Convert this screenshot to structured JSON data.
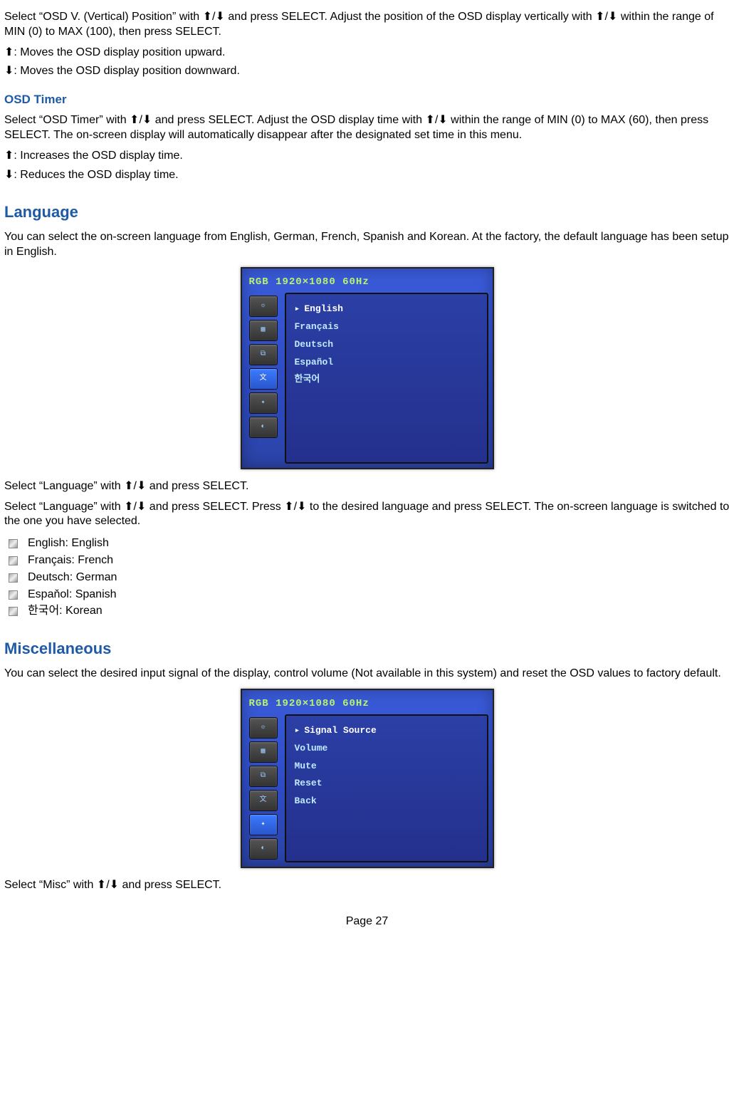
{
  "osdv": {
    "p1": "Select “OSD V. (Vertical) Position” with ⬆/⬇ and press SELECT. Adjust the position of the OSD display vertically with ⬆/⬇ within the range of MIN (0) to MAX (100), then press SELECT.",
    "up": "⬆: Moves the OSD display position upward.",
    "down": "⬇: Moves the OSD display position downward."
  },
  "timer": {
    "title": "OSD Timer",
    "p1": "Select “OSD Timer” with ⬆/⬇ and press SELECT. Adjust the OSD display time with ⬆/⬇ within the range of MIN (0) to MAX (60), then press SELECT. The on-screen display will automatically disappear after the designated set time in this menu.",
    "up": "⬆: Increases the OSD display time.",
    "down": "⬇: Reduces the OSD display time."
  },
  "language": {
    "title": "Language",
    "p1": "You can select the on-screen language from English, German, French, Spanish and Korean. At the factory, the default language has been setup in English.",
    "p2": "Select “Language” with ⬆/⬇ and press SELECT.",
    "p3": "Select “Language” with ⬆/⬇ and press SELECT. Press ⬆/⬇ to the desired language and press SELECT. The on-screen language is switched to the one you have selected.",
    "list": {
      "en": "English: English",
      "fr": "Français: French",
      "de": "Deutsch: German",
      "es": "Espaňol: Spanish",
      "ko": "한국어: Korean"
    },
    "osd_head": "RGB  1920×1080  60Hz",
    "osd_items": {
      "i0": "English",
      "i1": "Français",
      "i2": "Deutsch",
      "i3": "Español",
      "i4": "한국어"
    }
  },
  "misc": {
    "title": "Miscellaneous",
    "p1": "You can select the desired input signal of the display, control volume (Not available in this system) and reset the OSD values to factory default.",
    "p2": "Select “Misc” with ⬆/⬇ and press SELECT.",
    "osd_head": "RGB  1920×1080  60Hz",
    "osd_items": {
      "i0": "Signal Source",
      "i1": "Volume",
      "i2": "Mute",
      "i3": "Reset",
      "i4": "Back"
    }
  },
  "page": "Page 27"
}
